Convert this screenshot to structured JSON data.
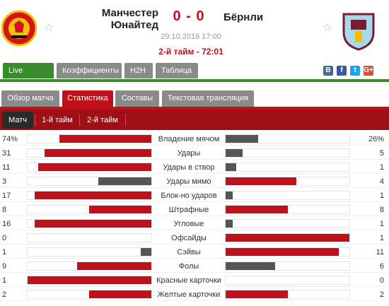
{
  "match": {
    "home_team": "Манчестер Юнайтед",
    "home_line1": "Манчестер",
    "home_line2": "Юнайтед",
    "away_team": "Бёрнли",
    "score": "0 - 0",
    "date": "29.10.2016 17:00",
    "status": "2-й тайм - 72:01"
  },
  "top_tabs": [
    {
      "label": "Live Centre",
      "active": true
    },
    {
      "label": "Коэффициенты",
      "active": false
    },
    {
      "label": "H2H",
      "active": false
    },
    {
      "label": "Таблица",
      "active": false
    }
  ],
  "social": {
    "vk": "B",
    "fb": "f",
    "tw": "t",
    "gp": "G+"
  },
  "sub_tabs": [
    {
      "label": "Обзор матча",
      "active": false
    },
    {
      "label": "Статистика",
      "active": true
    },
    {
      "label": "Составы",
      "active": false
    },
    {
      "label": "Текстовая трансляция",
      "active": false
    }
  ],
  "period_tabs": [
    {
      "label": "Матч",
      "active": true
    },
    {
      "label": "1-й тайм",
      "active": false
    },
    {
      "label": "2-й тайм",
      "active": false
    }
  ],
  "colors": {
    "leader": "#c0101a",
    "trailer": "#555555",
    "live_tab": "#3a8a2e",
    "accent_red": "#c0101a"
  },
  "stats": [
    {
      "label": "Владение мячом",
      "home": "74%",
      "away": "26%",
      "h": 74,
      "a": 26
    },
    {
      "label": "Удары",
      "home": "31",
      "away": "5",
      "h": 31,
      "a": 5
    },
    {
      "label": "Удары в створ",
      "home": "11",
      "away": "1",
      "h": 11,
      "a": 1
    },
    {
      "label": "Удары мимо",
      "home": "3",
      "away": "4",
      "h": 3,
      "a": 4
    },
    {
      "label": "Блок-но ударов",
      "home": "17",
      "away": "1",
      "h": 17,
      "a": 1
    },
    {
      "label": "Штрафные",
      "home": "8",
      "away": "8",
      "h": 8,
      "a": 8
    },
    {
      "label": "Угловые",
      "home": "16",
      "away": "1",
      "h": 16,
      "a": 1
    },
    {
      "label": "Офсайды",
      "home": "0",
      "away": "1",
      "h": 0,
      "a": 1
    },
    {
      "label": "Сэйвы",
      "home": "1",
      "away": "11",
      "h": 1,
      "a": 11
    },
    {
      "label": "Фолы",
      "home": "9",
      "away": "6",
      "h": 9,
      "a": 6
    },
    {
      "label": "Красные карточки",
      "home": "1",
      "away": "0",
      "h": 1,
      "a": 0
    },
    {
      "label": "Желтые карточки",
      "home": "2",
      "away": "2",
      "h": 2,
      "a": 2
    }
  ]
}
